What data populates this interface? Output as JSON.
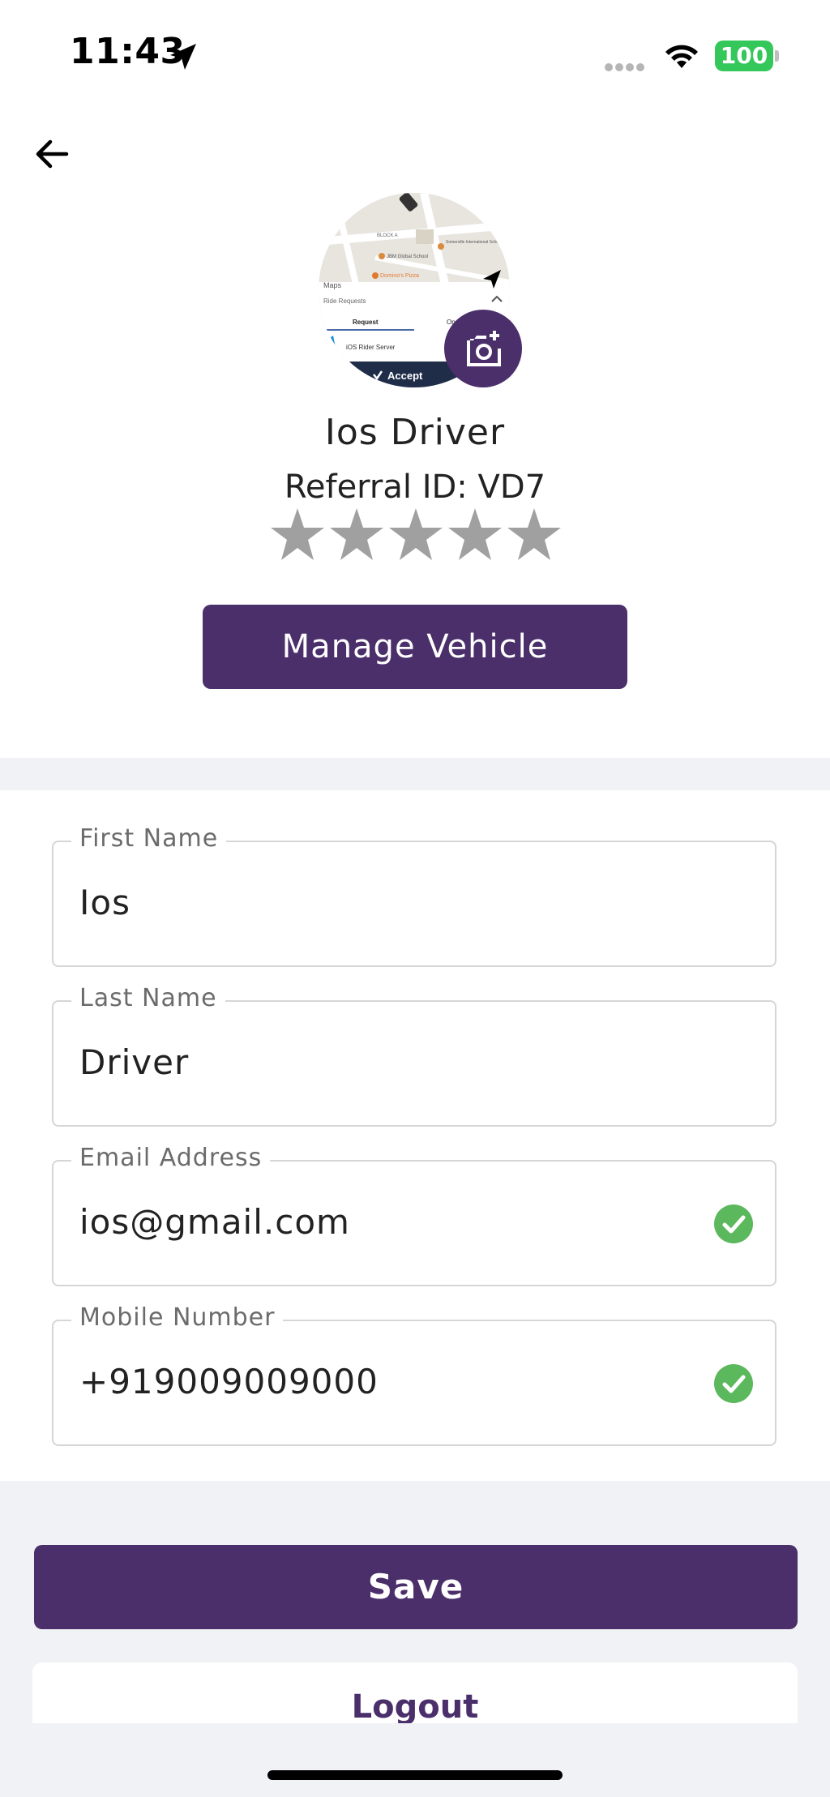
{
  "status_bar": {
    "time": "11:43",
    "battery": "100"
  },
  "profile": {
    "name": "Ios Driver",
    "referral": "Referral ID: VD7",
    "rating_stars": 5,
    "rating_filled": 0,
    "manage_vehicle_label": "Manage Vehicle",
    "avatar_screenshot": {
      "maps_label": "Maps",
      "block_label": "BLOCK A",
      "place_1": "JBM Global School",
      "place_2": "Somerville International School",
      "place_3": "Domino's Pizza",
      "ride_requests": "Ride Requests",
      "tab_request": "Request",
      "tab_other": "On",
      "rider": "iOS Rider Server",
      "accept": "Accept"
    }
  },
  "form": {
    "first_name": {
      "label": "First Name",
      "value": "Ios"
    },
    "last_name": {
      "label": "Last Name",
      "value": "Driver"
    },
    "email": {
      "label": "Email Address",
      "value": "ios@gmail.com"
    },
    "mobile": {
      "label": "Mobile Number",
      "value": "+919009009000"
    }
  },
  "actions": {
    "save_label": "Save",
    "logout_label": "Logout"
  },
  "colors": {
    "primary": "#4a2f6b",
    "verified": "#5cb85c",
    "star": "#a0a0a0",
    "background": "#f1f2f6"
  }
}
